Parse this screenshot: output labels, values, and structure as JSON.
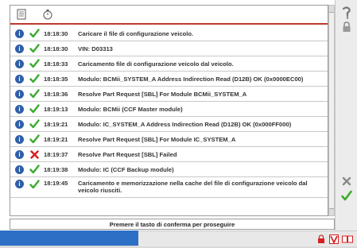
{
  "header": {
    "icons": [
      "document-icon",
      "stopwatch-icon"
    ]
  },
  "log": {
    "rows": [
      {
        "status": "ok",
        "time": "18:18:30",
        "message": "Caricare il file di configurazione veicolo."
      },
      {
        "status": "ok",
        "time": "18:18:30",
        "message": "VIN: D03313"
      },
      {
        "status": "ok",
        "time": "18:18:33",
        "message": "Caricamento file di configurazione veicolo dal veicolo."
      },
      {
        "status": "ok",
        "time": "18:18:35",
        "message": "Modulo: BCMii_SYSTEM_A Address Indirection Read (D12B) OK (0x0000EC00)"
      },
      {
        "status": "ok",
        "time": "18:18:36",
        "message": "Resolve Part Request [SBL] For Module BCMii_SYSTEM_A"
      },
      {
        "status": "ok",
        "time": "18:19:13",
        "message": "Modulo: BCMii (CCF Master module)"
      },
      {
        "status": "ok",
        "time": "18:19:21",
        "message": "Modulo: IC_SYSTEM_A Address Indirection Read (D12B) OK (0x000FF000)"
      },
      {
        "status": "ok",
        "time": "18:19:21",
        "message": "Resolve Part Request [SBL] For Module IC_SYSTEM_A"
      },
      {
        "status": "fail",
        "time": "18:19:37",
        "message": "Resolve Part Request [SBL] Failed"
      },
      {
        "status": "ok",
        "time": "18:19:38",
        "message": "Modulo: IC (CCF Backup module)"
      },
      {
        "status": "ok",
        "time": "18:19:45",
        "message": "Caricamento e memorizzazione nella cache del file di configurazione veicolo dal veicolo riusciti."
      }
    ]
  },
  "prompt": {
    "text": "Premere il tasto di conferma per proseguire"
  },
  "sidebar": {
    "icons": [
      "help-icon",
      "lock-icon",
      "cancel-icon",
      "confirm-icon"
    ]
  },
  "colors": {
    "ok": "#3cab2f",
    "fail": "#d62020",
    "info": "#2f5fa8",
    "accent": "#c0392b",
    "taskbar": "#2e6fc6"
  }
}
